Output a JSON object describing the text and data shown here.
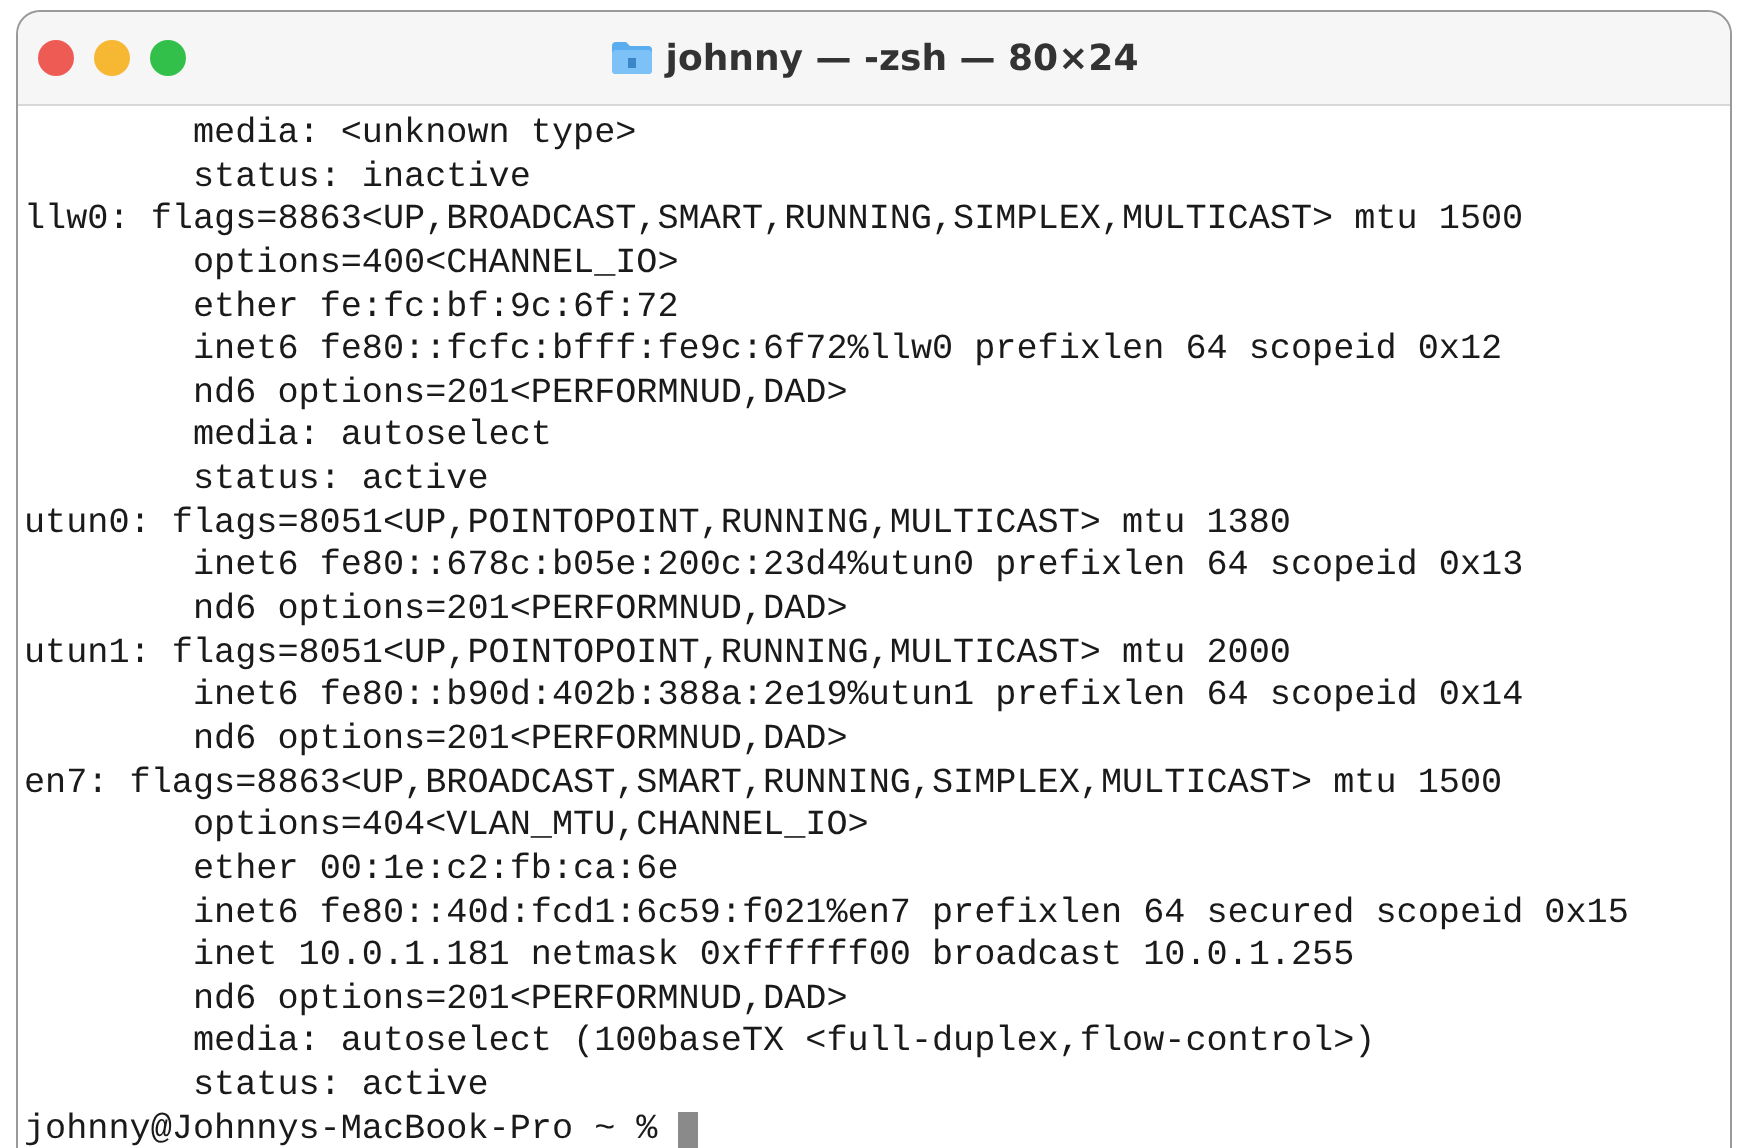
{
  "window": {
    "title": "johnny — -zsh — 80×24"
  },
  "terminal": {
    "lines": [
      "\tmedia: <unknown type>",
      "\tstatus: inactive",
      "llw0: flags=8863<UP,BROADCAST,SMART,RUNNING,SIMPLEX,MULTICAST> mtu 1500",
      "\toptions=400<CHANNEL_IO>",
      "\tether fe:fc:bf:9c:6f:72",
      "\tinet6 fe80::fcfc:bfff:fe9c:6f72%llw0 prefixlen 64 scopeid 0x12",
      "\tnd6 options=201<PERFORMNUD,DAD>",
      "\tmedia: autoselect",
      "\tstatus: active",
      "utun0: flags=8051<UP,POINTOPOINT,RUNNING,MULTICAST> mtu 1380",
      "\tinet6 fe80::678c:b05e:200c:23d4%utun0 prefixlen 64 scopeid 0x13",
      "\tnd6 options=201<PERFORMNUD,DAD>",
      "utun1: flags=8051<UP,POINTOPOINT,RUNNING,MULTICAST> mtu 2000",
      "\tinet6 fe80::b90d:402b:388a:2e19%utun1 prefixlen 64 scopeid 0x14",
      "\tnd6 options=201<PERFORMNUD,DAD>",
      "en7: flags=8863<UP,BROADCAST,SMART,RUNNING,SIMPLEX,MULTICAST> mtu 1500",
      "\toptions=404<VLAN_MTU,CHANNEL_IO>",
      "\tether 00:1e:c2:fb:ca:6e",
      "\tinet6 fe80::40d:fcd1:6c59:f021%en7 prefixlen 64 secured scopeid 0x15",
      "\tinet 10.0.1.181 netmask 0xffffff00 broadcast 10.0.1.255",
      "\tnd6 options=201<PERFORMNUD,DAD>",
      "\tmedia: autoselect (100baseTX <full-duplex,flow-control>)",
      "\tstatus: active"
    ],
    "prompt": "johnny@Johnnys-MacBook-Pro ~ %"
  }
}
